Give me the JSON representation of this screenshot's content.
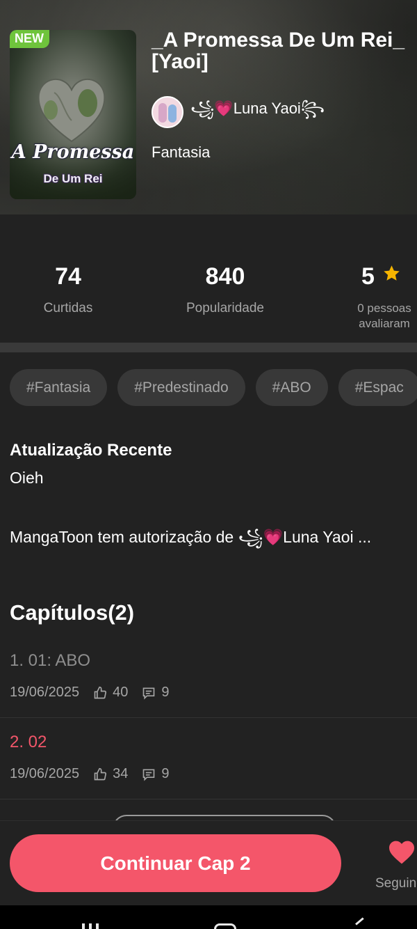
{
  "work": {
    "badge": "NEW",
    "title": "_A Promessa De Um Rei_ [Yaoi]",
    "cover_title_line1": "A Promessa",
    "cover_title_line2": "De Um Rei",
    "author": "꧁💗Luna Yaoi꧂",
    "genre": "Fantasia"
  },
  "stats": [
    {
      "value": "74",
      "label": "Curtidas"
    },
    {
      "value": "840",
      "label": "Popularidade"
    },
    {
      "value": "5",
      "label": "0 pessoas avaliaram"
    }
  ],
  "tags": [
    "#Fantasia",
    "#Predestinado",
    "#ABO",
    "#Espac"
  ],
  "recent": {
    "heading": "Atualização Recente",
    "text": "Oieh",
    "authorization": "MangaToon tem autorização de ꧁💗Luna Yaoi ..."
  },
  "chapters": {
    "heading": "Capítulos(2)",
    "items": [
      {
        "title": "1. 01: ABO",
        "date": "19/06/2025",
        "likes": "40",
        "comments": "9"
      },
      {
        "title": "2. 02",
        "date": "19/06/2025",
        "likes": "34",
        "comments": "9"
      }
    ]
  },
  "actions": {
    "continue_label": "Continuar Cap 2",
    "follow_label": "Seguindo"
  },
  "colors": {
    "accent": "#f4566a",
    "star": "#f5b400",
    "new_badge": "#6fc43c"
  }
}
